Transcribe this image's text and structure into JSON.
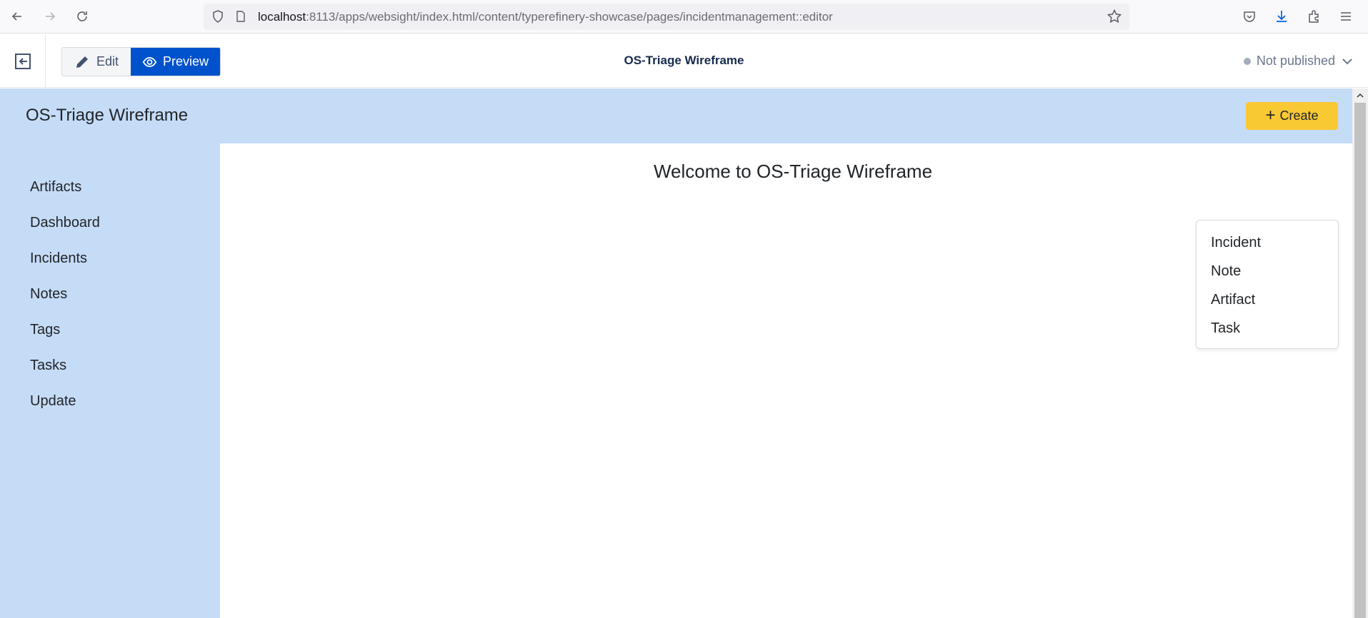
{
  "browser": {
    "url_host": "localhost",
    "url_path": ":8113/apps/websight/index.html/content/typerefinery-showcase/pages/incidentmanagement::editor",
    "icons": [
      "back-icon",
      "forward-icon",
      "reload-icon",
      "shield-icon",
      "page-icon",
      "bookmark-star-icon",
      "pocket-icon",
      "download-icon",
      "extensions-icon",
      "menu-icon"
    ]
  },
  "editor": {
    "edit_label": "Edit",
    "preview_label": "Preview",
    "page_title": "OS-Triage Wireframe",
    "publish_status": "Not published"
  },
  "app": {
    "title": "OS-Triage Wireframe",
    "create_label": "Create",
    "welcome": "Welcome to OS-Triage Wireframe",
    "sidebar": {
      "items": [
        {
          "label": "Artifacts"
        },
        {
          "label": "Dashboard"
        },
        {
          "label": "Incidents"
        },
        {
          "label": "Notes"
        },
        {
          "label": "Tags"
        },
        {
          "label": "Tasks"
        },
        {
          "label": "Update"
        }
      ]
    },
    "create_menu": {
      "items": [
        {
          "label": "Incident"
        },
        {
          "label": "Note"
        },
        {
          "label": "Artifact"
        },
        {
          "label": "Task"
        }
      ]
    }
  },
  "colors": {
    "accent_blue": "#0052cc",
    "header_bg": "#c5dcf7",
    "create_button": "#f9c933"
  }
}
